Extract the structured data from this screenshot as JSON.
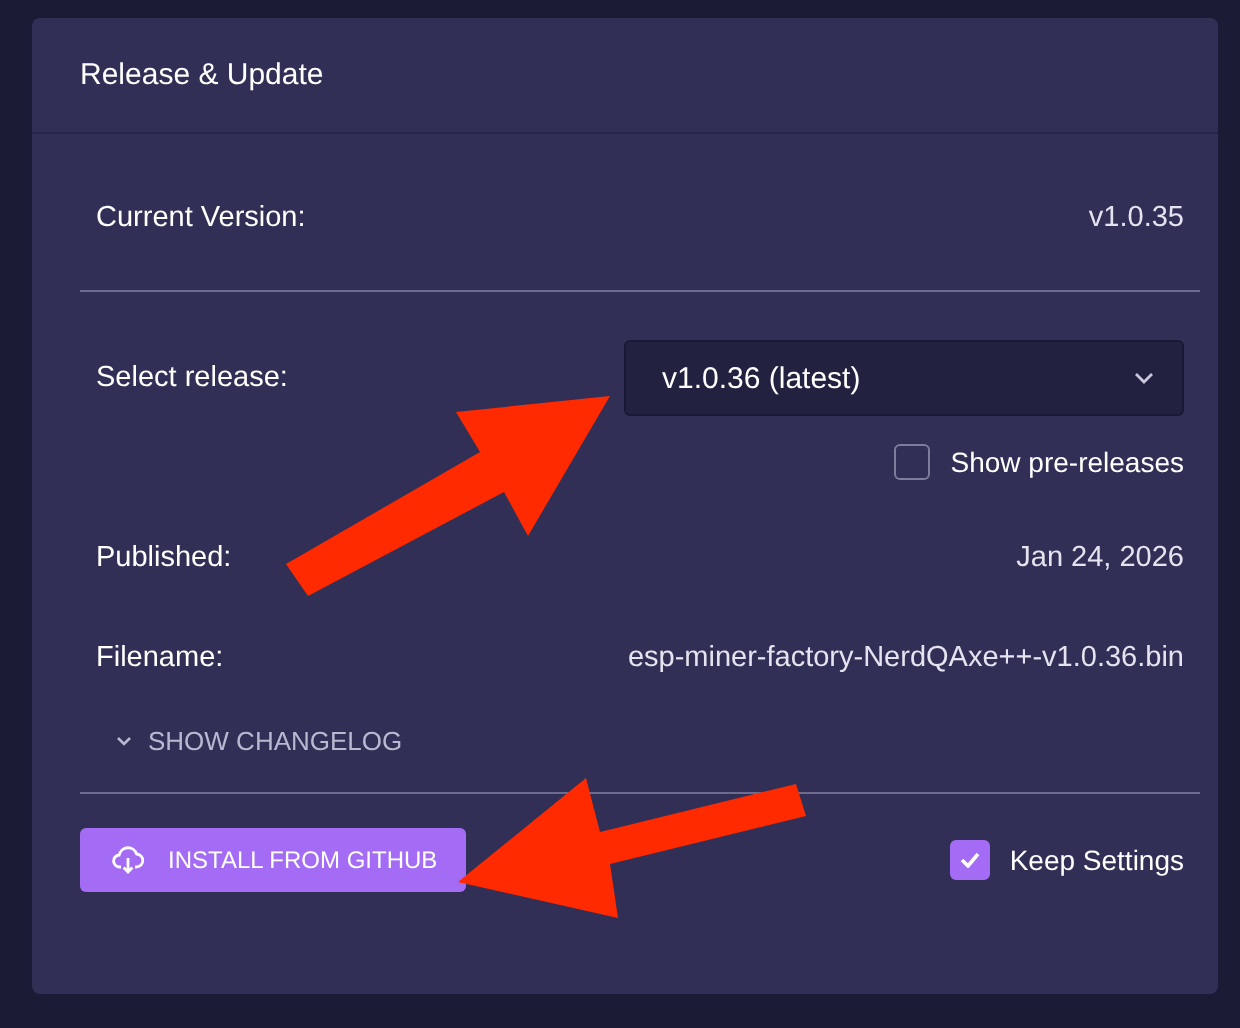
{
  "card": {
    "title": "Release & Update"
  },
  "current_version": {
    "label": "Current Version:",
    "value": "v1.0.35"
  },
  "release_select": {
    "label": "Select release:",
    "value": "v1.0.36 (latest)"
  },
  "show_prereleases": {
    "label": "Show pre-releases",
    "checked": false
  },
  "details": [
    {
      "label": "Published:",
      "value": "Jan 24, 2026"
    },
    {
      "label": "Filename:",
      "value": "esp-miner-factory-NerdQAxe++-v1.0.36.bin"
    }
  ],
  "changelog_toggle": {
    "label": "SHOW CHANGELOG",
    "expanded": false
  },
  "install_button": {
    "label": "INSTALL FROM GITHUB"
  },
  "keep_settings": {
    "label": "Keep Settings",
    "checked": true
  }
}
